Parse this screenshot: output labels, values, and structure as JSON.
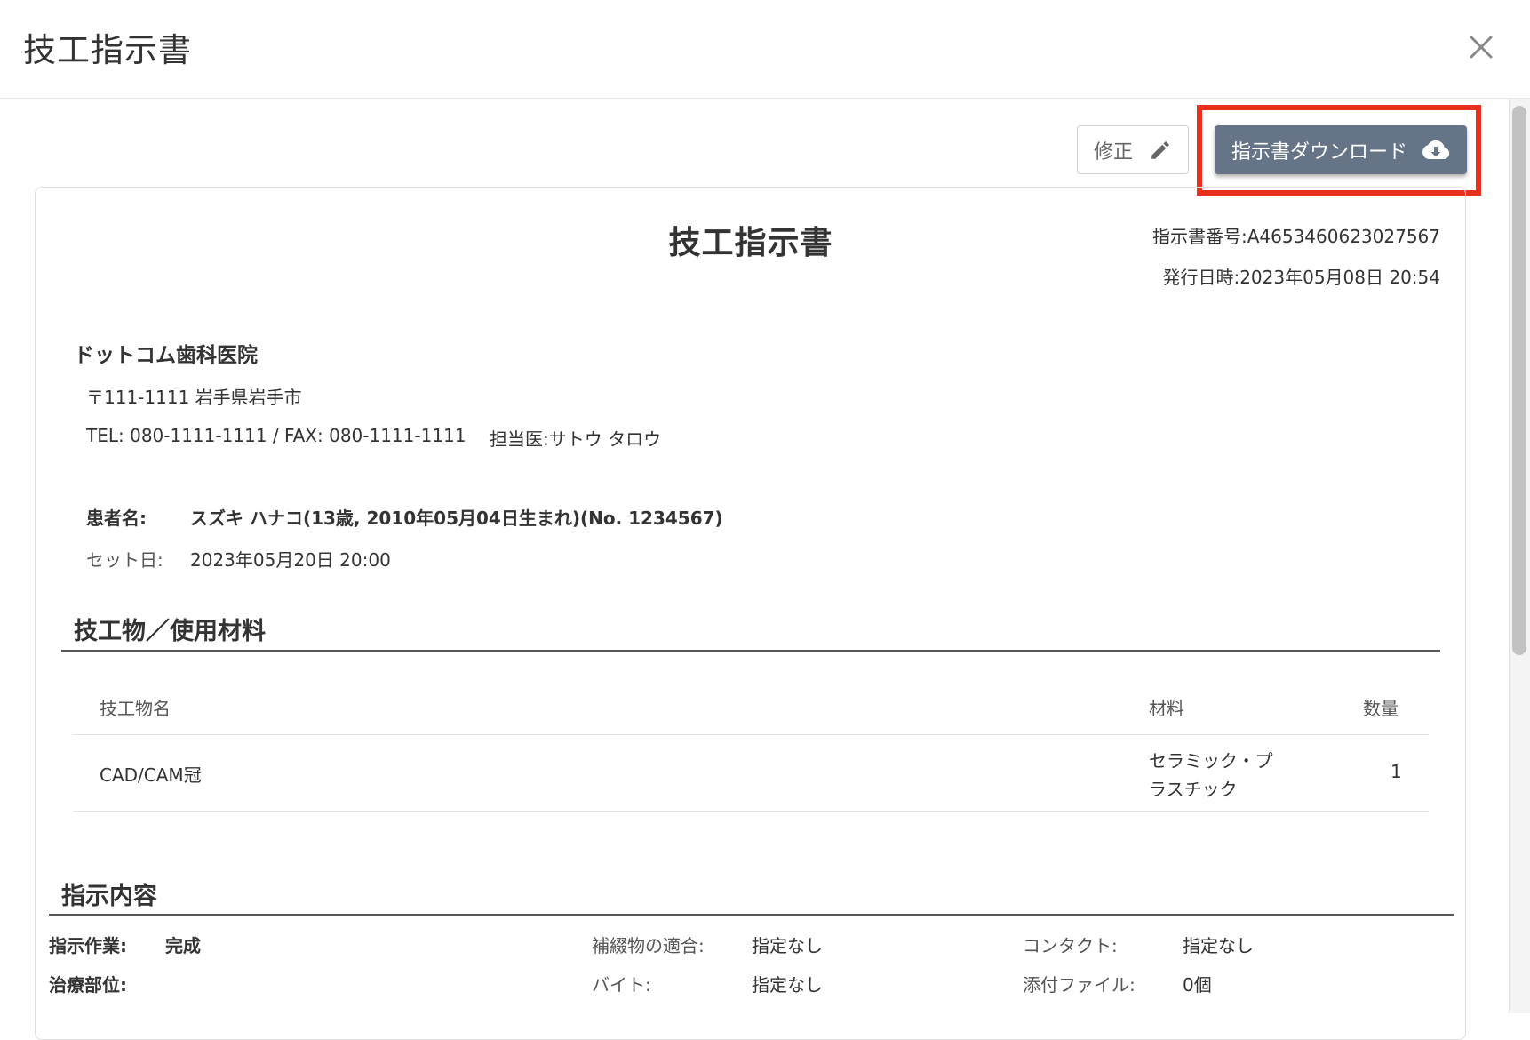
{
  "modal": {
    "title": "技工指示書",
    "close_icon": "close-icon"
  },
  "toolbar": {
    "edit_label": "修正",
    "edit_icon": "pencil-icon",
    "download_label": "指示書ダウンロード",
    "download_icon": "cloud-download-icon",
    "download_color": "#657487",
    "highlight_color": "#e8301e"
  },
  "document": {
    "title": "技工指示書",
    "number": "指示書番号:A4653460623027567",
    "issued": "発行日時:2023年05月08日 20:54"
  },
  "clinic": {
    "name": "ドットコム歯科医院",
    "address": "〒111-1111 岩手県岩手市",
    "contact": "TEL: 080-1111-1111 / FAX: 080-1111-1111",
    "doctor": "担当医:サトウ タロウ"
  },
  "patient": {
    "name_label": "患者名:",
    "name_value": "スズキ ハナコ(13歳, 2010年05月04日生まれ)(No. 1234567)",
    "set_label": "セット日:",
    "set_value": "2023年05月20日 20:00"
  },
  "products": {
    "section_title": "技工物／使用材料",
    "columns": [
      "技工物名",
      "材料",
      "数量"
    ],
    "rows": [
      {
        "name": "CAD/CAM冠",
        "material_line1": "セラミック・プ",
        "material_line2": "ラスチック",
        "qty": "1"
      }
    ]
  },
  "instructions": {
    "section_title": "指示内容",
    "work_label": "指示作業:",
    "work_value": "完成",
    "site_label": "治療部位:",
    "fit_label": "補綴物の適合:",
    "fit_value": "指定なし",
    "bite_label": "バイト:",
    "bite_value": "指定なし",
    "contact_label": "コンタクト:",
    "contact_value": "指定なし",
    "attach_label": "添付ファイル:",
    "attach_value": "0個"
  }
}
